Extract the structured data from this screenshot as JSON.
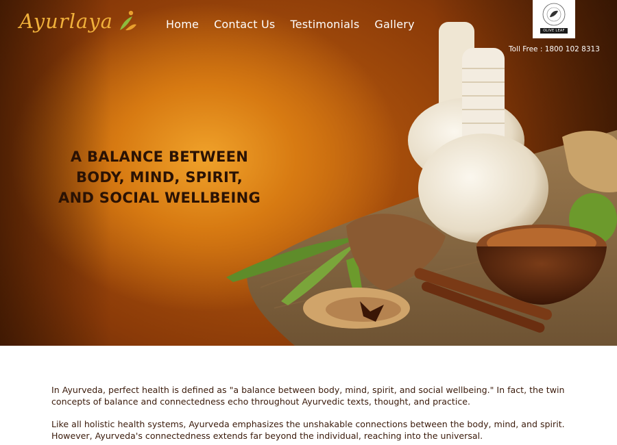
{
  "brand": {
    "logo_text": "Ayurlaya"
  },
  "nav": {
    "items": [
      {
        "label": "Home"
      },
      {
        "label": "Contact Us"
      },
      {
        "label": "Testimonials"
      },
      {
        "label": "Gallery"
      }
    ]
  },
  "badge": {
    "label": "OLIVE LEAF"
  },
  "toll_free": "Toll Free : 1800 102 8313",
  "hero": {
    "headline_lines": [
      "A BALANCE BETWEEN",
      "BODY, MIND, SPIRIT,",
      "AND SOCIAL WELLBEING"
    ]
  },
  "content": {
    "paragraphs": [
      "In Ayurveda, perfect health is defined as \"a balance between body, mind, spirit, and social wellbeing.\" In fact, the twin concepts of balance and connectedness echo throughout Ayurvedic texts, thought, and practice.",
      "Like all holistic health systems, Ayurveda emphasizes the unshakable connections between the body, mind, and spirit. However, Ayurveda's connectedness extends far beyond the individual, reaching into the universal."
    ]
  },
  "colors": {
    "hero_glow": "#f0a22a",
    "hero_dark": "#3d1804",
    "logo_gold": "#f1b13b",
    "headline_text": "#2a1204",
    "body_text": "#3a1a0a"
  },
  "icons": [
    "leaf-figure-icon",
    "olive-leaf-badge-icon"
  ]
}
